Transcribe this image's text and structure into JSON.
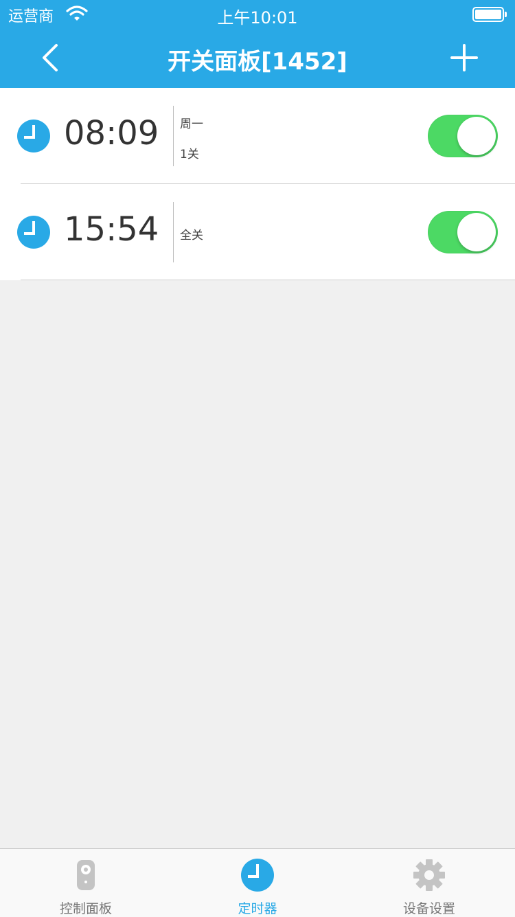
{
  "status": {
    "carrier": "运营商",
    "time": "上午10:01"
  },
  "nav": {
    "title": "开关面板[1452]"
  },
  "timers": [
    {
      "time": "08:09",
      "details": [
        "周一",
        "1关"
      ],
      "enabled": true
    },
    {
      "time": "15:54",
      "details": [
        "全关"
      ],
      "enabled": true
    }
  ],
  "tabs": [
    {
      "label": "控制面板",
      "icon": "remote-icon",
      "active": false
    },
    {
      "label": "定时器",
      "icon": "clock-icon",
      "active": true
    },
    {
      "label": "设备设置",
      "icon": "gear-icon",
      "active": false
    }
  ],
  "colors": {
    "accent": "#29a9e6",
    "toggle_on": "#4cd964",
    "background": "#f0f0f0"
  }
}
